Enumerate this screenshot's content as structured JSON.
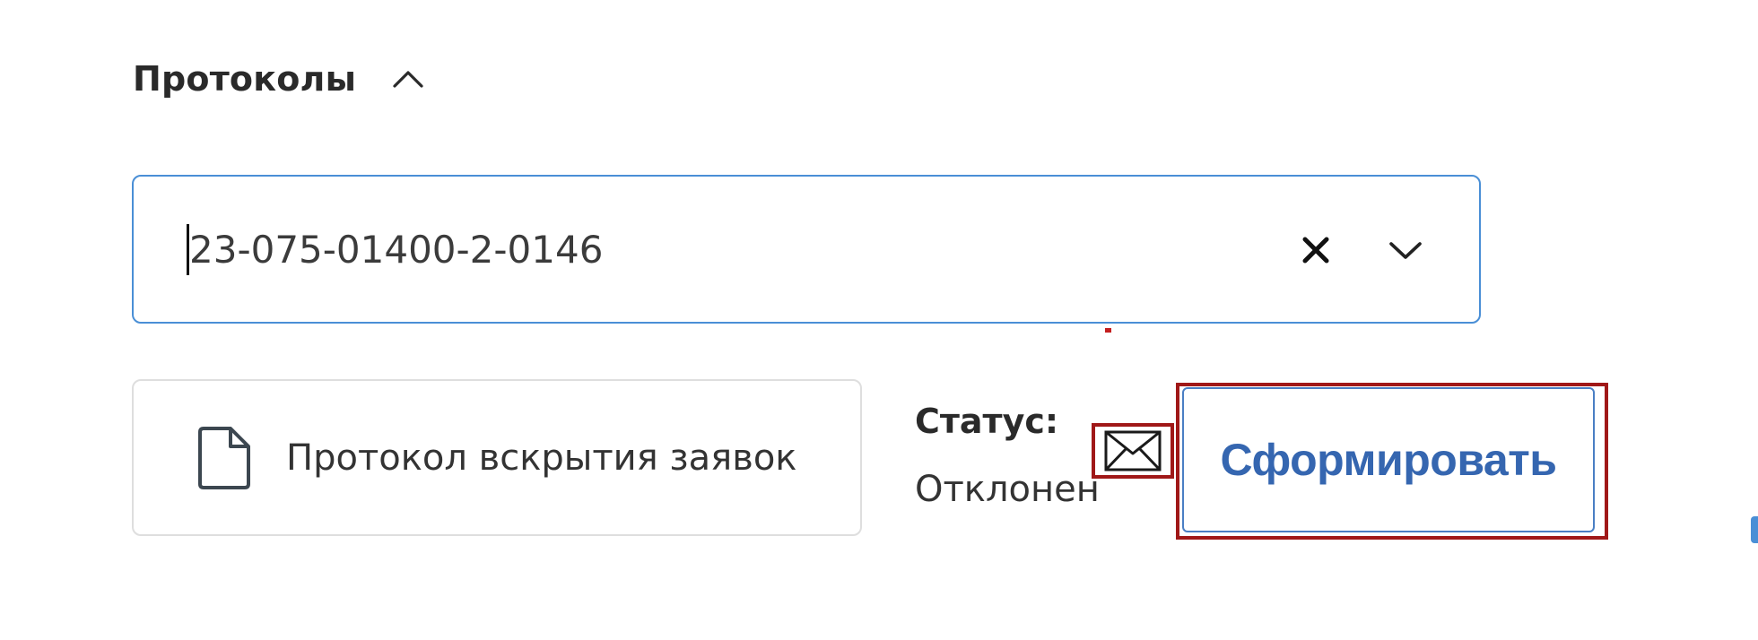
{
  "section": {
    "title": "Протоколы",
    "toggle_icon": "chevron-up-icon"
  },
  "protocol_select": {
    "value": "23-075-01400-2-0146",
    "clear_icon": "close-icon",
    "dropdown_icon": "chevron-down-icon",
    "border_color": "#4a8fd6"
  },
  "document": {
    "icon": "document-icon",
    "label": "Протокол вскрытия заявок"
  },
  "status": {
    "title": "Статус:",
    "value": "Отклонен"
  },
  "actions": {
    "mail_icon": "envelope-icon",
    "generate_label": "Сформировать",
    "generate_color": "#3566b0",
    "highlight_color": "#a01818"
  }
}
